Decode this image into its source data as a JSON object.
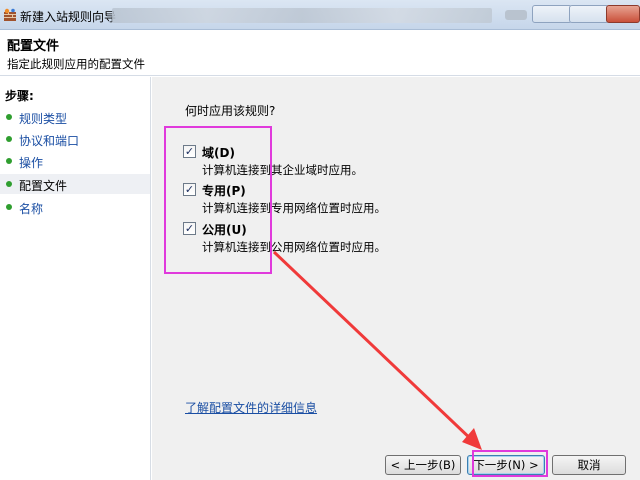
{
  "window": {
    "title": "新建入站规则向导"
  },
  "header": {
    "title": "配置文件",
    "description": "指定此规则应用的配置文件"
  },
  "sidebar": {
    "label": "步骤:",
    "items": [
      {
        "label": "规则类型"
      },
      {
        "label": "协议和端口"
      },
      {
        "label": "操作"
      },
      {
        "label": "配置文件"
      },
      {
        "label": "名称"
      }
    ]
  },
  "main": {
    "question": "何时应用该规则?",
    "options": [
      {
        "label": "域(D)",
        "description": "计算机连接到其企业域时应用。",
        "checked": true
      },
      {
        "label": "专用(P)",
        "description": "计算机连接到专用网络位置时应用。",
        "checked": true
      },
      {
        "label": "公用(U)",
        "description": "计算机连接到公用网络位置时应用。",
        "checked": true
      }
    ],
    "learn_more_link": "了解配置文件的详细信息"
  },
  "buttons": {
    "back": "< 上一步(B)",
    "next": "下一步(N) >",
    "cancel": "取消"
  },
  "colors": {
    "annotation": "#e03adc",
    "arrow": "#f03a3a",
    "link": "#1a4ea3",
    "step_dot": "#2f9e2f"
  },
  "icons": {
    "app": "firewall-icon",
    "check": "✓"
  }
}
